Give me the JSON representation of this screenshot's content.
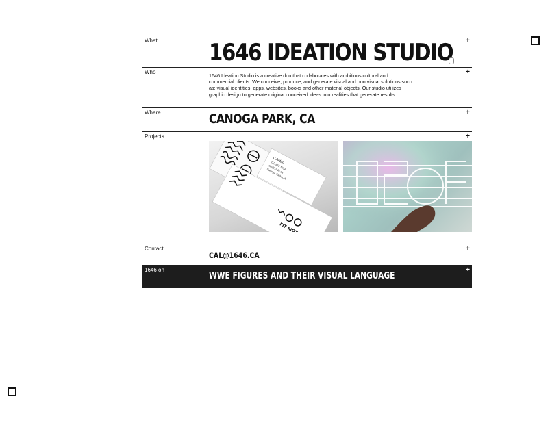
{
  "rows": {
    "what": {
      "label": "What",
      "title": "1646 IDEATION STUDIO"
    },
    "who": {
      "label": "Who",
      "description": "1646 Ideation Studio is a creative duo that collaborates with ambitious cultural and commercial clients. We conceive, produce, and generate visual and non visual solutions such as: visual identities, apps, websites, books and other material objects. Our studio utilizes graphic design to generate original conceived ideas into realities that generate results."
    },
    "where": {
      "label": "Where",
      "value": "CANOGA PARK, CA"
    },
    "projects": {
      "label": "Projects",
      "items": [
        {
          "name": "stationery-mockup",
          "card_name": "C.Aldan",
          "card_lines": [
            "310 555 1234",
            "cal@1646.ca",
            "Canoga Park, CA"
          ],
          "logo_text": "FIT RIOT"
        },
        {
          "name": "holographic-poster"
        }
      ]
    },
    "contact": {
      "label": "Contact",
      "email": "CAL@1646.CA"
    },
    "on": {
      "label": "1646 on",
      "value": "WWE FIGURES AND THEIR VISUAL LANGUAGE"
    }
  },
  "expand_symbol": "+",
  "colors": {
    "on_bg": "#1d1d1d",
    "text": "#111111"
  }
}
